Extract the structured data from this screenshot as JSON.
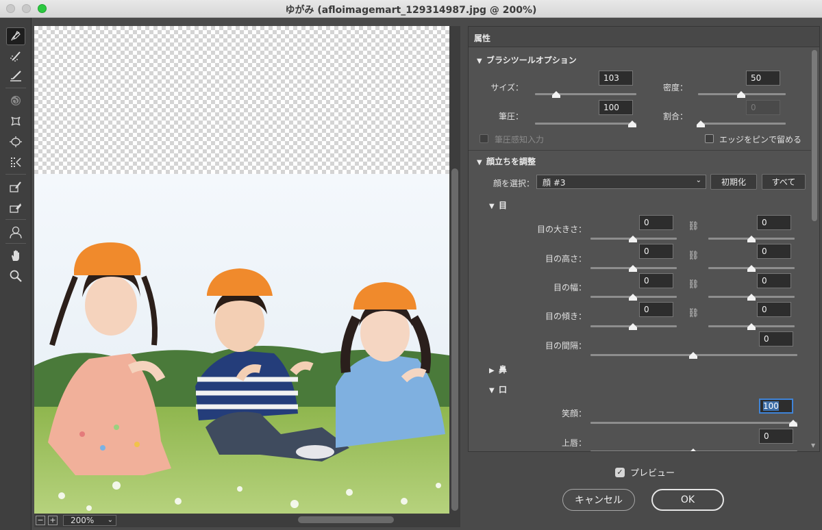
{
  "window": {
    "title": "ゆがみ (afloimagemart_129314987.jpg @ 200%)"
  },
  "tools": [
    {
      "name": "forward-warp-tool-icon"
    },
    {
      "name": "reconstruct-tool-icon"
    },
    {
      "name": "smooth-tool-icon"
    },
    {
      "name": "twirl-tool-icon"
    },
    {
      "name": "pucker-tool-icon"
    },
    {
      "name": "bloat-tool-icon"
    },
    {
      "name": "push-left-tool-icon"
    },
    {
      "name": "freeze-mask-tool-icon"
    },
    {
      "name": "thaw-mask-tool-icon"
    },
    {
      "name": "face-tool-icon"
    },
    {
      "name": "hand-tool-icon"
    },
    {
      "name": "zoom-tool-icon"
    }
  ],
  "canvas": {
    "zoom_minus": "−",
    "zoom_plus": "+",
    "zoom_value": "200%"
  },
  "panel": {
    "title": "属性",
    "brush": {
      "section_title": "ブラシツールオプション",
      "size_label": "サイズ：",
      "size_value": "103",
      "density_label": "密度：",
      "density_value": "50",
      "pressure_label": "筆圧：",
      "pressure_value": "100",
      "rate_label": "割合：",
      "rate_value": "0",
      "stylus_label": "筆圧感知入力",
      "pin_edges_label": "エッジをピンで留める"
    },
    "face": {
      "section_title": "顔立ちを調整",
      "select_label": "顔を選択：",
      "select_value": "顔 #3",
      "reset_button": "初期化",
      "all_button": "すべて",
      "eyes_title": "目",
      "eye_size_label": "目の大きさ：",
      "eye_size_left": "0",
      "eye_size_right": "0",
      "eye_height_label": "目の高さ：",
      "eye_height_left": "0",
      "eye_height_right": "0",
      "eye_width_label": "目の幅：",
      "eye_width_left": "0",
      "eye_width_right": "0",
      "eye_tilt_label": "目の傾き：",
      "eye_tilt_left": "0",
      "eye_tilt_right": "0",
      "eye_distance_label": "目の間隔：",
      "eye_distance_value": "0",
      "nose_title": "鼻",
      "mouth_title": "口",
      "smile_label": "笑顔：",
      "smile_value": "100",
      "upper_lip_label": "上唇：",
      "upper_lip_value": "0"
    }
  },
  "footer": {
    "preview_label": "プレビュー",
    "cancel_button": "キャンセル",
    "ok_button": "OK"
  },
  "colors": {
    "panel_bg": "#525252",
    "accent": "#3f84d8"
  }
}
